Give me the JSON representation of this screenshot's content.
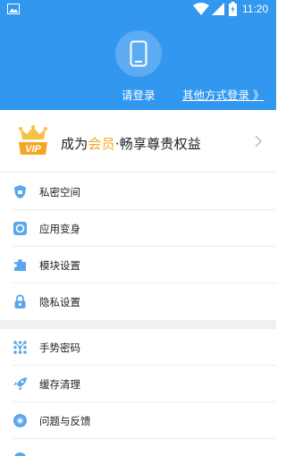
{
  "status_bar": {
    "time": "11:20"
  },
  "header": {
    "login_label": "请登录",
    "other_login_label": "其他方式登录 》"
  },
  "vip": {
    "prefix": "成为",
    "highlight": "会员",
    "suffix": "·畅享尊贵权益",
    "badge_text": "VIP"
  },
  "menu_group_1": [
    {
      "label": "私密空间",
      "icon": "shield-icon"
    },
    {
      "label": "应用变身",
      "icon": "app-transform-icon"
    },
    {
      "label": "模块设置",
      "icon": "puzzle-icon"
    },
    {
      "label": "隐私设置",
      "icon": "lock-icon"
    }
  ],
  "menu_group_2": [
    {
      "label": "手势密码",
      "icon": "gesture-icon"
    },
    {
      "label": "缓存清理",
      "icon": "rocket-icon"
    },
    {
      "label": "问题与反馈",
      "icon": "feedback-icon"
    }
  ],
  "colors": {
    "primary": "#3197ef",
    "accent": "#f5a623"
  }
}
